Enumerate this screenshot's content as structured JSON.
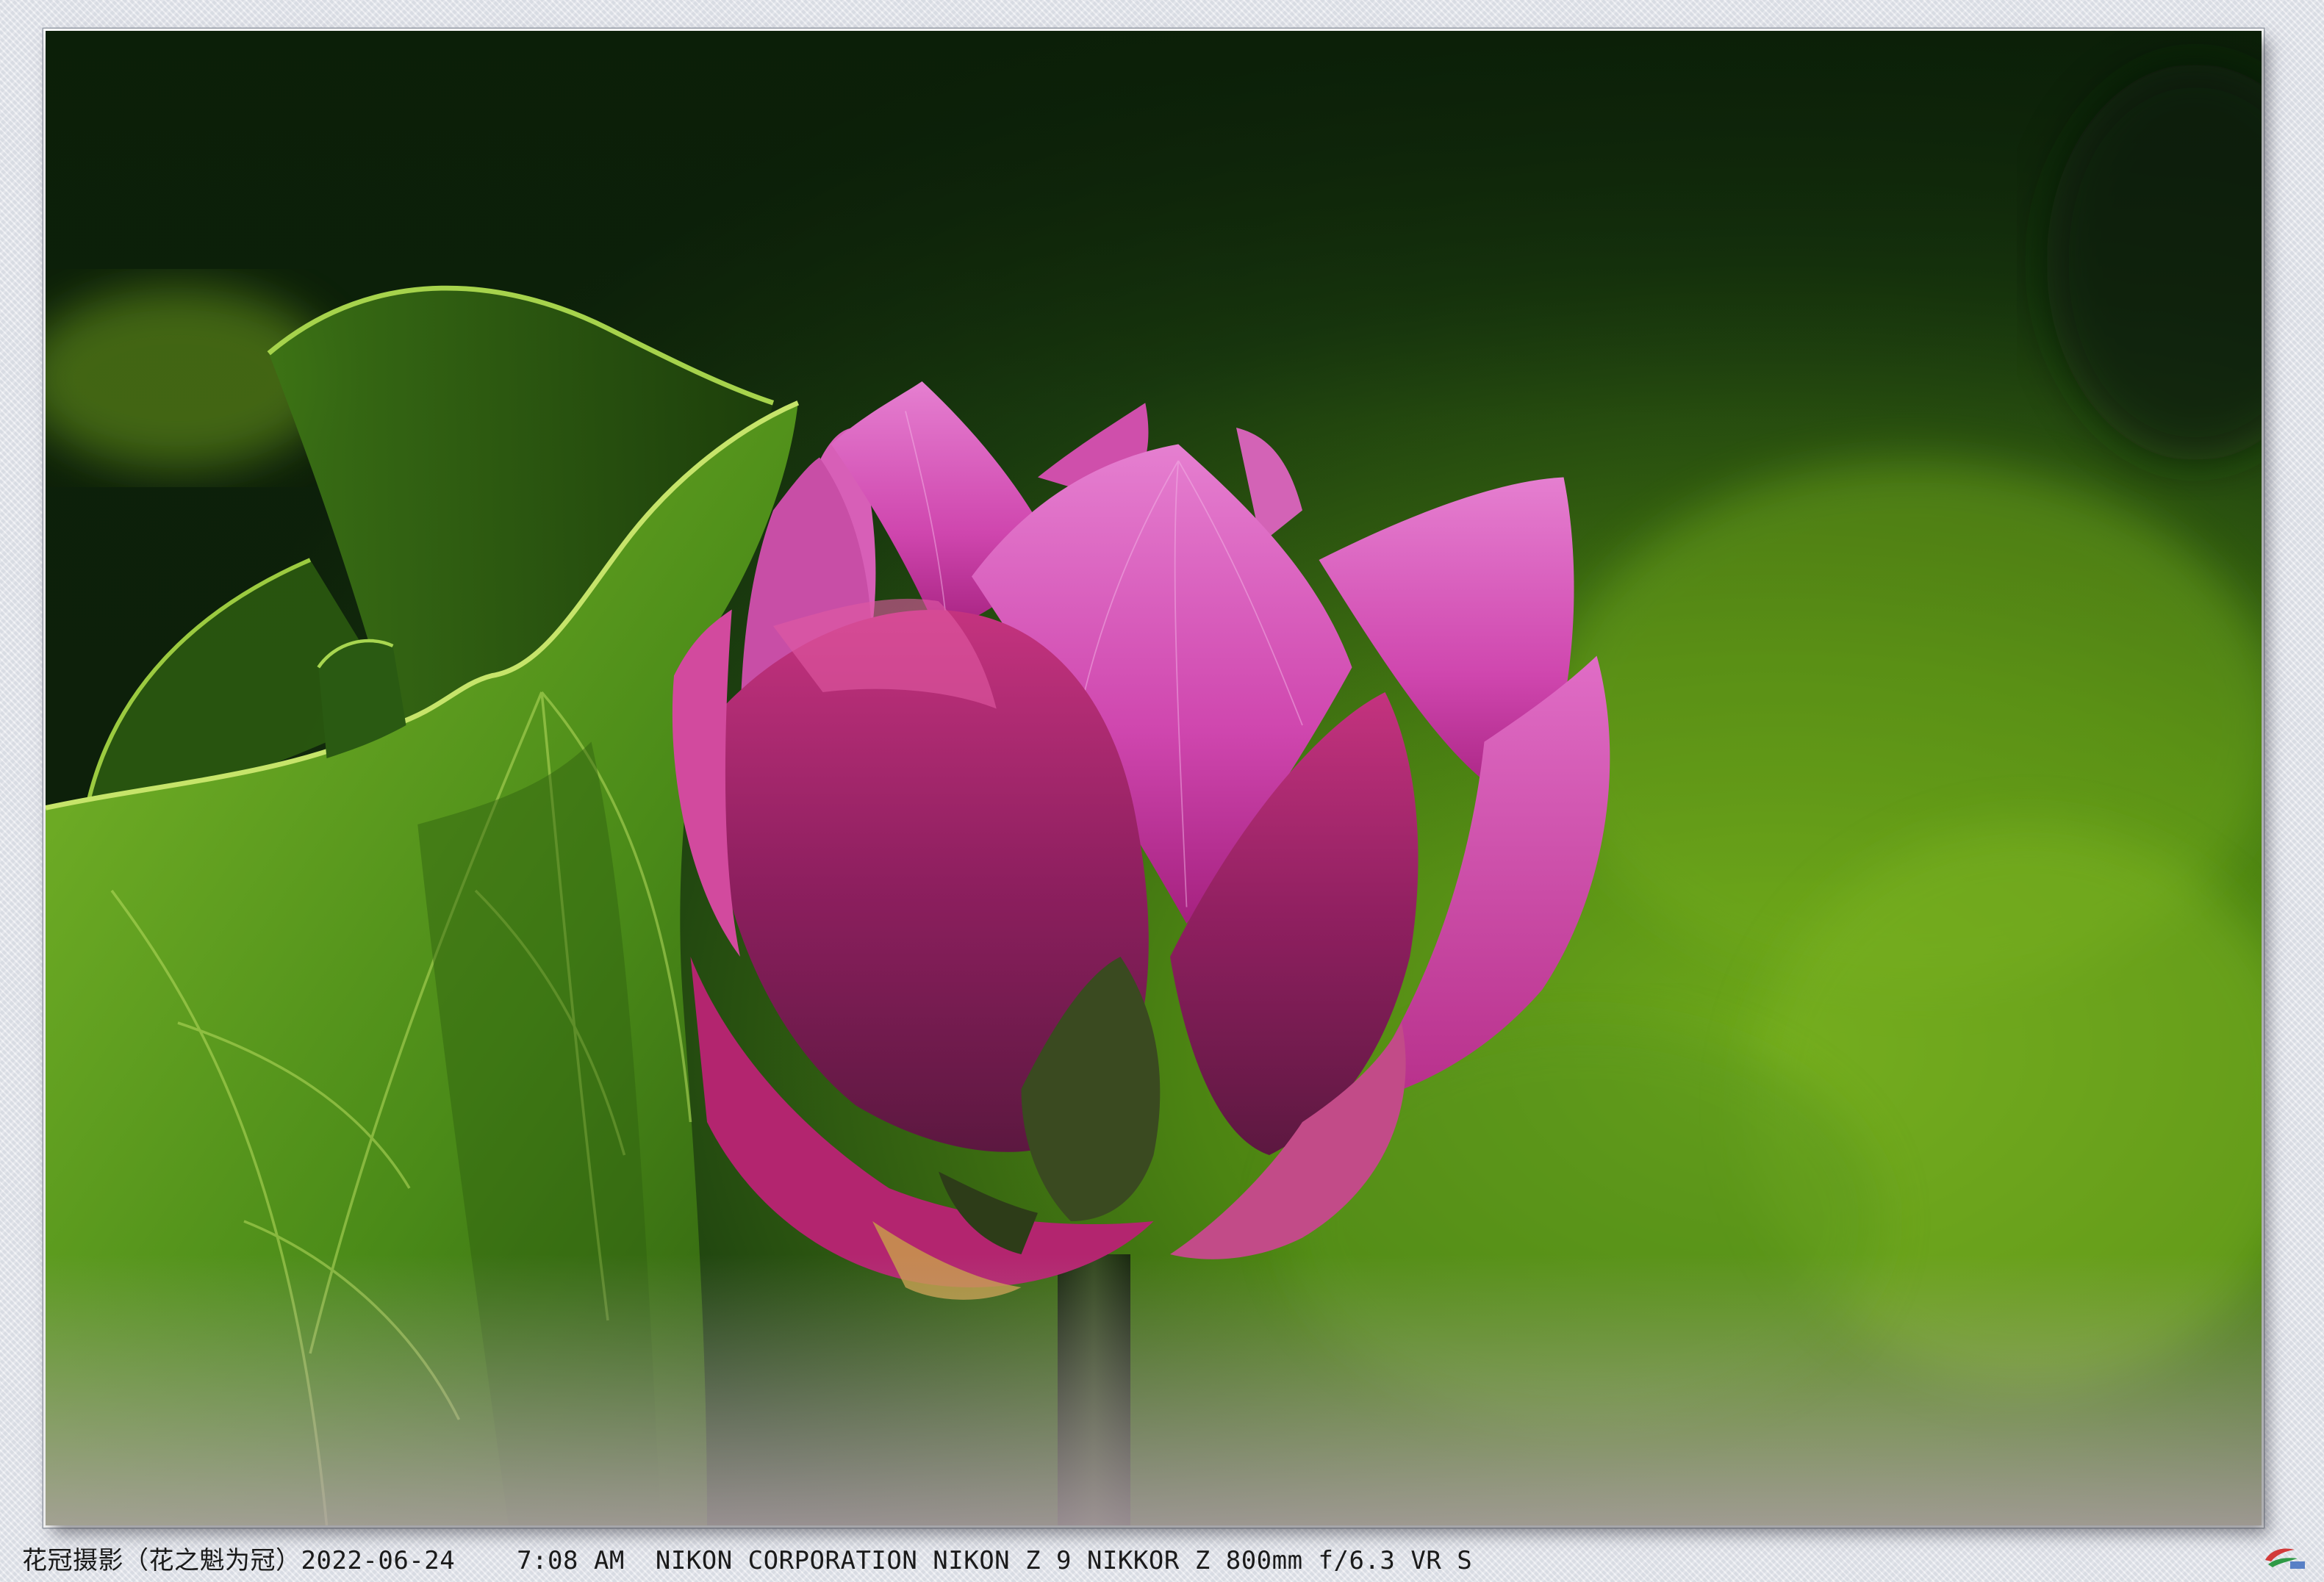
{
  "caption": {
    "source": "花冠摄影（花之魁为冠）",
    "date": "2022-06-24",
    "time": "7:08 AM",
    "camera": "NIKON CORPORATION NIKON Z 9 NIKKOR Z 800mm f/6.3 VR S"
  },
  "scene": {
    "subject": "lotus-bud",
    "colors": {
      "petal_pink": "#d0359a",
      "petal_light": "#e472c8",
      "leaf_green": "#5f9e1e",
      "background_dark": "#0f2409",
      "background_bright": "#6aa21a"
    }
  },
  "watermark": {
    "icon": "site-logo-icon"
  }
}
